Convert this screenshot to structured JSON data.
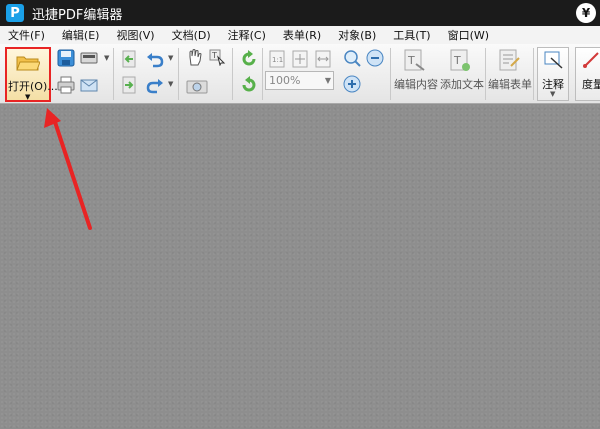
{
  "app": {
    "title": "迅捷PDF编辑器",
    "logo_letter": "P",
    "top_right_icon": "¥"
  },
  "menu": [
    "文件(F)",
    "编辑(E)",
    "视图(V)",
    "文档(D)",
    "注释(C)",
    "表单(R)",
    "对象(B)",
    "工具(T)",
    "窗口(W)"
  ],
  "toolbar": {
    "open_label": "打开(O)...",
    "zoom_value": "100%",
    "edit_content_label": "编辑内容",
    "add_text_label": "添加文本",
    "edit_form_label": "编辑表单",
    "annotate_label": "注释",
    "measure_label": "度量"
  },
  "icons": {
    "open": "folder-icon",
    "save": "save-icon",
    "print": "print-icon",
    "scan": "scanner-icon",
    "email": "email-icon",
    "back": "back-icon",
    "undo": "undo-icon",
    "redo": "redo-icon",
    "hand": "hand-icon",
    "select_text": "select-text-icon",
    "snapshot": "camera-icon",
    "rotate": "rotate-icon"
  },
  "colors": {
    "highlight": "#e82424",
    "accent": "#1aa0e8",
    "titlebar": "#1b1b1b"
  }
}
